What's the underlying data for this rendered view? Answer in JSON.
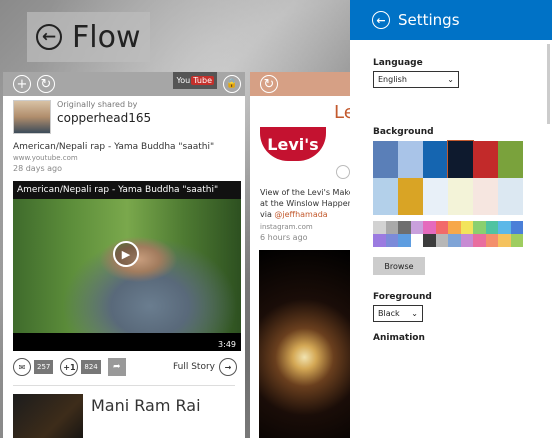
{
  "app": {
    "title": "Flow",
    "back_icon": "back-arrow-icon"
  },
  "card1": {
    "toolbar_icons": [
      "plus-icon",
      "refresh-icon"
    ],
    "source_badge": "YouTube",
    "shared_label": "Originally shared by",
    "shared_user": "copperhead165",
    "post_title": "American/Nepali rap - Yama Buddha \"saathi\"",
    "post_source": "www.youtube.com",
    "post_ago": "28 days ago",
    "video_title": "American/Nepali rap - Yama Buddha \"saathi\"",
    "video_duration": "3:49",
    "comments": "257",
    "plus_label": "+1",
    "plus_count": "824",
    "full_story_label": "Full Story",
    "next_title": "Mani Ram Rai"
  },
  "card2": {
    "heading": "Le",
    "logo_text": "Levi's",
    "desc_line1": "View of the Levi's Makers",
    "desc_line2": "at the Winslow Happenin",
    "desc_prefix": "via ",
    "mention": "@jeffhamada",
    "source": "instagram.com",
    "ago": "6 hours ago"
  },
  "settings": {
    "title": "Settings",
    "language_label": "Language",
    "language_value": "English",
    "background_label": "Background",
    "background_tiles": [
      "#5a7fb8",
      "#a9c4e8",
      "#1565b0",
      "#0e1a2e",
      "#c22a2a",
      "#7aa23c",
      "#b3d0ea",
      "#d9a425",
      "#e8f0f8",
      "#f3f3d8",
      "#f6e6e0",
      "#dce8f2"
    ],
    "swatch_colors": [
      "#d2d2d2",
      "#a9a9a9",
      "#6e6e6e",
      "#c9a0dc",
      "#e56abd",
      "#f26a6a",
      "#f7a84a",
      "#f2e45c",
      "#8ad06f",
      "#4fc3a1",
      "#5bb8e8",
      "#4a7fd8",
      "#9b7be0",
      "#7c8bd9",
      "#5e9de0",
      "#ffffff",
      "#3c3c3c",
      "#b7b7b7",
      "#7fa4d6",
      "#c78bd3",
      "#e96e9f",
      "#f38f6c",
      "#f4c25e",
      "#9ecd60"
    ],
    "browse_label": "Browse",
    "foreground_label": "Foreground",
    "foreground_value": "Black",
    "animation_label": "Animation"
  }
}
